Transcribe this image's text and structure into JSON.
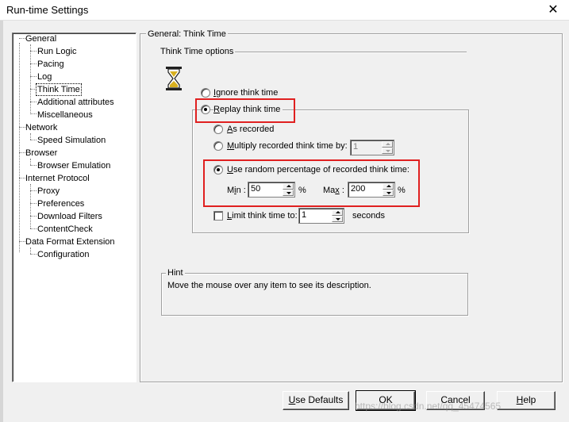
{
  "window": {
    "title": "Run-time Settings",
    "close_glyph": "✕"
  },
  "tree": {
    "items": [
      {
        "label": "General",
        "level": 0
      },
      {
        "label": "Run Logic",
        "level": 1
      },
      {
        "label": "Pacing",
        "level": 1
      },
      {
        "label": "Log",
        "level": 1
      },
      {
        "label": "Think Time",
        "level": 1,
        "selected": true
      },
      {
        "label": "Additional attributes",
        "level": 1
      },
      {
        "label": "Miscellaneous",
        "level": 1
      },
      {
        "label": "Network",
        "level": 0
      },
      {
        "label": "Speed Simulation",
        "level": 1
      },
      {
        "label": "Browser",
        "level": 0
      },
      {
        "label": "Browser Emulation",
        "level": 1
      },
      {
        "label": "Internet Protocol",
        "level": 0
      },
      {
        "label": "Proxy",
        "level": 1
      },
      {
        "label": "Preferences",
        "level": 1
      },
      {
        "label": "Download Filters",
        "level": 1
      },
      {
        "label": "ContentCheck",
        "level": 1
      },
      {
        "label": "Data Format Extension",
        "level": 0
      },
      {
        "label": "Configuration",
        "level": 1
      }
    ]
  },
  "panel": {
    "header": "General: Think Time",
    "options_group": "Think Time options",
    "ignore": {
      "label_rest": "gnore think time",
      "accel": "I",
      "selected": false
    },
    "replay": {
      "label_rest": "eplay think time",
      "accel": "R",
      "selected": true
    },
    "as_recorded": {
      "accel": "A",
      "label_rest": "s recorded",
      "selected": false
    },
    "multiply": {
      "accel": "M",
      "label_rest": "ultiply recorded think time by:",
      "value": "1",
      "selected": false
    },
    "random": {
      "accel": "U",
      "label_rest": "se random percentage of recorded think time:",
      "selected": true
    },
    "min": {
      "accel": "i",
      "pre": "M",
      "post": "n :",
      "value": "50",
      "unit": "%"
    },
    "max": {
      "accel": "x",
      "pre": "Ma",
      "post": " :",
      "value": "200",
      "unit": "%"
    },
    "limit": {
      "accel": "L",
      "label_rest": "imit think time to:",
      "value": "1",
      "unit": "seconds",
      "checked": false
    },
    "hint_title": "Hint",
    "hint_text": "Move the mouse over any item to see its description."
  },
  "buttons": {
    "use_defaults": {
      "accel": "U",
      "rest": "se Defaults"
    },
    "ok": "OK",
    "cancel": "Cancel",
    "help": {
      "accel": "H",
      "rest": "elp"
    }
  },
  "watermark": "https://blog.csdn.net/qq_45474565",
  "colors": {
    "highlight_red": "#e02020",
    "hourglass_sand": "#d8b020"
  }
}
